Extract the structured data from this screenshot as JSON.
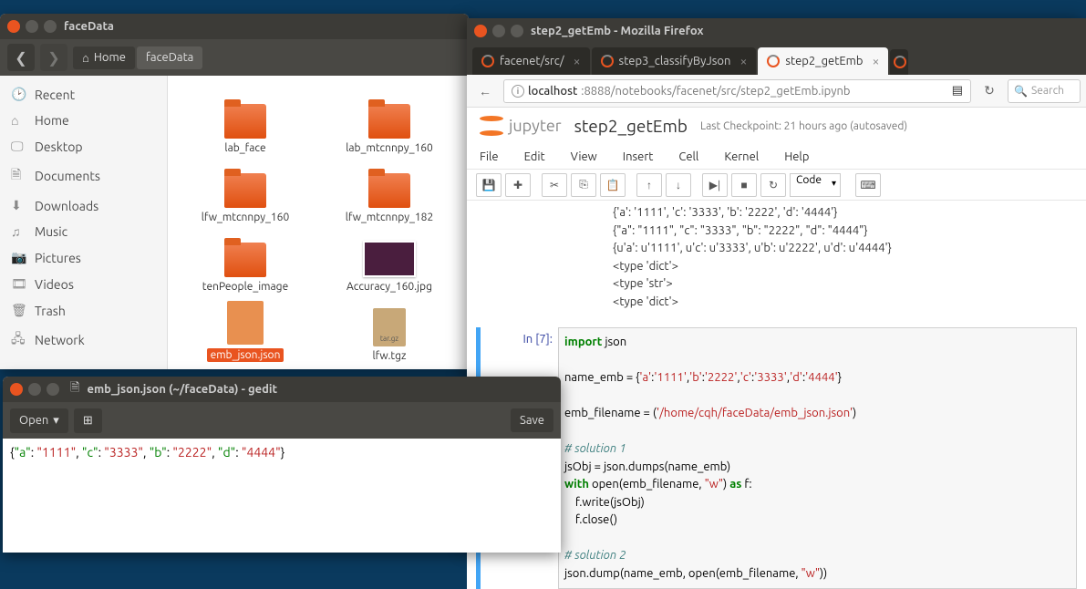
{
  "filemanager": {
    "title": "faceData",
    "breadcrumb": {
      "home": "Home",
      "current": "faceData"
    },
    "sidebar": [
      {
        "icon": "🕑",
        "label": "Recent"
      },
      {
        "icon": "⌂",
        "label": "Home"
      },
      {
        "icon": "🖵",
        "label": "Desktop"
      },
      {
        "icon": "🗎",
        "label": "Documents"
      },
      {
        "icon": "⬇",
        "label": "Downloads"
      },
      {
        "icon": "♫",
        "label": "Music"
      },
      {
        "icon": "📷",
        "label": "Pictures"
      },
      {
        "icon": "🎞",
        "label": "Videos"
      },
      {
        "icon": "🗑",
        "label": "Trash"
      },
      {
        "icon": "🖧",
        "label": "Network"
      }
    ],
    "files": [
      {
        "type": "folder",
        "name": "lab_face"
      },
      {
        "type": "folder",
        "name": "lab_mtcnnpy_160"
      },
      {
        "type": "folder",
        "name": "lfw_mtcnnpy_160"
      },
      {
        "type": "folder",
        "name": "lfw_mtcnnpy_182"
      },
      {
        "type": "folder",
        "name": "tenPeople_image"
      },
      {
        "type": "image",
        "name": "Accuracy_160.jpg"
      },
      {
        "type": "json",
        "name": "emb_json.json",
        "selected": true
      },
      {
        "type": "tgz",
        "name": "lfw.tgz"
      }
    ]
  },
  "firefox": {
    "title": "step2_getEmb - Mozilla Firefox",
    "tabs": [
      {
        "label": "facenet/src/",
        "active": false
      },
      {
        "label": "step3_classifyByJson",
        "active": false
      },
      {
        "label": "step2_getEmb",
        "active": true
      }
    ],
    "url_host": "localhost",
    "url_rest": ":8888/notebooks/facenet/src/step2_getEmb.ipynb",
    "search_placeholder": "Search"
  },
  "jupyter": {
    "logo_text": "jupyter",
    "nb_title": "step2_getEmb",
    "checkpoint": "Last Checkpoint: 21 hours ago (autosaved)",
    "menu": [
      "File",
      "Edit",
      "View",
      "Insert",
      "Cell",
      "Kernel",
      "Help"
    ],
    "cell_type": "Code",
    "output_lines": "{'a': '1111', 'c': '3333', 'b': '2222', 'd': '4444'}\n{\"a\": \"1111\", \"c\": \"3333\", \"b\": \"2222\", \"d\": \"4444\"}\n{u'a': u'1111', u'c': u'3333', u'b': u'2222', u'd': u'4444'}\n<type 'dict'>\n<type 'str'>\n<type 'dict'>",
    "prompt": "In [7]:",
    "code": {
      "l1a": "import",
      "l1b": " json",
      "l2a": "name_emb = {",
      "l2b": "'a'",
      "l2c": ":",
      "l2d": "'1111'",
      "l2e": ",",
      "l2f": "'b'",
      "l2g": ":",
      "l2h": "'2222'",
      "l2i": ",",
      "l2j": "'c'",
      "l2k": ":",
      "l2l": "'3333'",
      "l2m": ",",
      "l2n": "'d'",
      "l2o": ":",
      "l2p": "'4444'",
      "l2q": "}",
      "l3a": "emb_filename = (",
      "l3b": "'/home/cqh/faceData/emb_json.json'",
      "l3c": ")",
      "l4": "# solution 1",
      "l5": "jsObj = json.dumps(name_emb)",
      "l6a": "with",
      "l6b": " open(emb_filename, ",
      "l6c": "\"w\"",
      "l6d": ") ",
      "l6e": "as",
      "l6f": " f:",
      "l7": "    f.write(jsObj)",
      "l8": "    f.close()",
      "l9": "# solution 2",
      "l10a": "json.dump(name_emb, open(emb_filename, ",
      "l10b": "\"w\"",
      "l10c": "))"
    }
  },
  "gedit": {
    "title": "emb_json.json (~/faceData) - gedit",
    "open_label": "Open",
    "save_label": "Save",
    "content": {
      "brace_open": "{",
      "k1": "\"a\"",
      "v1": "\"1111\"",
      "k2": "\"c\"",
      "v2": "\"3333\"",
      "k3": "\"b\"",
      "v3": "\"2222\"",
      "k4": "\"d\"",
      "v4": "\"4444\"",
      "brace_close": "}",
      "colon": ": ",
      "comma": ", "
    }
  }
}
